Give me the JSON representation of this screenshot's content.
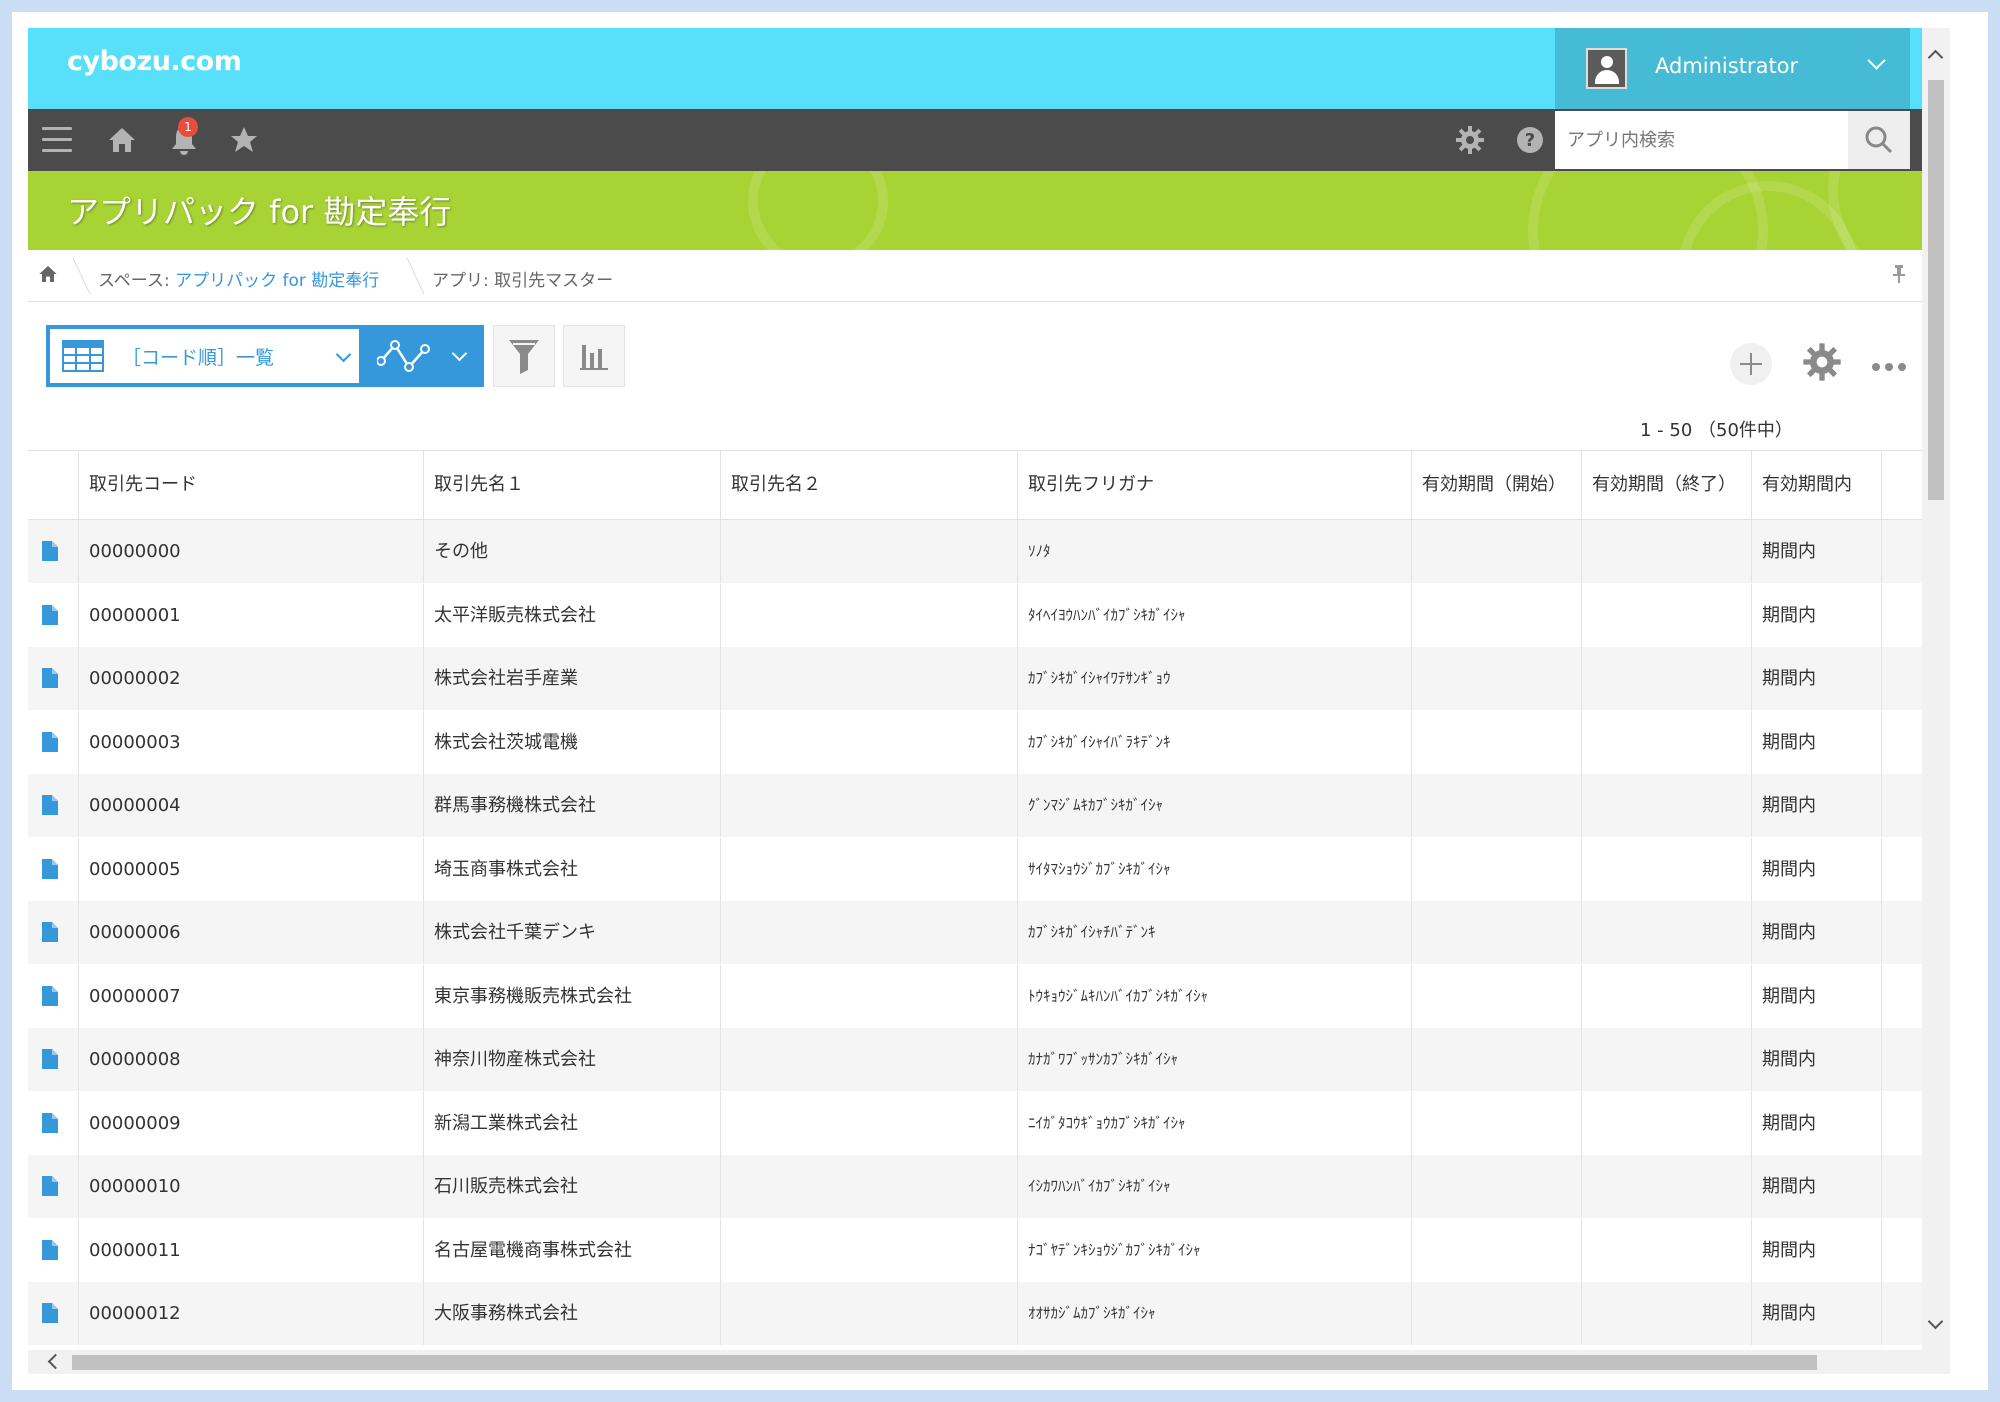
{
  "header": {
    "logo": "cybozu.com",
    "user_name": "Administrator",
    "notification_count": "1"
  },
  "search": {
    "placeholder": "アプリ内検索"
  },
  "banner": {
    "title": "アプリパック for 勘定奉行"
  },
  "breadcrumb": {
    "space_prefix": "スペース: ",
    "space_name": "アプリパック for 勘定奉行",
    "app_label": "アプリ: 取引先マスター"
  },
  "view": {
    "selected": "［コード順］一覧"
  },
  "pager": {
    "text": "1 - 50 （50件中）"
  },
  "table": {
    "columns": [
      "取引先コード",
      "取引先名１",
      "取引先名２",
      "取引先フリガナ",
      "有効期間（開始）",
      "有効期間（終了）",
      "有効期間内"
    ],
    "rows": [
      {
        "code": "00000000",
        "name1": "その他",
        "name2": "",
        "kana": "ｿﾉﾀ",
        "start": "",
        "end": "",
        "status": "期間内"
      },
      {
        "code": "00000001",
        "name1": "太平洋販売株式会社",
        "name2": "",
        "kana": "ﾀｲﾍｲﾖｳﾊﾝﾊﾞｲｶﾌﾞｼｷｶﾞｲｼｬ",
        "start": "",
        "end": "",
        "status": "期間内"
      },
      {
        "code": "00000002",
        "name1": "株式会社岩手産業",
        "name2": "",
        "kana": "ｶﾌﾞｼｷｶﾞｲｼｬｲﾜﾃｻﾝｷﾞｮｳ",
        "start": "",
        "end": "",
        "status": "期間内"
      },
      {
        "code": "00000003",
        "name1": "株式会社茨城電機",
        "name2": "",
        "kana": "ｶﾌﾞｼｷｶﾞｲｼｬｲﾊﾞﾗｷﾃﾞﾝｷ",
        "start": "",
        "end": "",
        "status": "期間内"
      },
      {
        "code": "00000004",
        "name1": "群馬事務機株式会社",
        "name2": "",
        "kana": "ｸﾞﾝﾏｼﾞﾑｷｶﾌﾞｼｷｶﾞｲｼｬ",
        "start": "",
        "end": "",
        "status": "期間内"
      },
      {
        "code": "00000005",
        "name1": "埼玉商事株式会社",
        "name2": "",
        "kana": "ｻｲﾀﾏｼｮｳｼﾞｶﾌﾞｼｷｶﾞｲｼｬ",
        "start": "",
        "end": "",
        "status": "期間内"
      },
      {
        "code": "00000006",
        "name1": "株式会社千葉デンキ",
        "name2": "",
        "kana": "ｶﾌﾞｼｷｶﾞｲｼｬﾁﾊﾞﾃﾞﾝｷ",
        "start": "",
        "end": "",
        "status": "期間内"
      },
      {
        "code": "00000007",
        "name1": "東京事務機販売株式会社",
        "name2": "",
        "kana": "ﾄｳｷｮｳｼﾞﾑｷﾊﾝﾊﾞｲｶﾌﾞｼｷｶﾞｲｼｬ",
        "start": "",
        "end": "",
        "status": "期間内"
      },
      {
        "code": "00000008",
        "name1": "神奈川物産株式会社",
        "name2": "",
        "kana": "ｶﾅｶﾞﾜﾌﾞｯｻﾝｶﾌﾞｼｷｶﾞｲｼｬ",
        "start": "",
        "end": "",
        "status": "期間内"
      },
      {
        "code": "00000009",
        "name1": "新潟工業株式会社",
        "name2": "",
        "kana": "ﾆｲｶﾞﾀｺｳｷﾞｮｳｶﾌﾞｼｷｶﾞｲｼｬ",
        "start": "",
        "end": "",
        "status": "期間内"
      },
      {
        "code": "00000010",
        "name1": "石川販売株式会社",
        "name2": "",
        "kana": "ｲｼｶﾜﾊﾝﾊﾞｲｶﾌﾞｼｷｶﾞｲｼｬ",
        "start": "",
        "end": "",
        "status": "期間内"
      },
      {
        "code": "00000011",
        "name1": "名古屋電機商事株式会社",
        "name2": "",
        "kana": "ﾅｺﾞﾔﾃﾞﾝｷｼｮｳｼﾞｶﾌﾞｼｷｶﾞｲｼｬ",
        "start": "",
        "end": "",
        "status": "期間内"
      },
      {
        "code": "00000012",
        "name1": "大阪事務株式会社",
        "name2": "",
        "kana": "ｵｵｻｶｼﾞﾑｶﾌﾞｼｷｶﾞｲｼｬ",
        "start": "",
        "end": "",
        "status": "期間内"
      }
    ]
  },
  "colors": {
    "header_bg": "#58e0fb",
    "toolbar_bg": "#4b4b4b",
    "banner_bg": "#a8d334",
    "accent": "#3498db"
  }
}
